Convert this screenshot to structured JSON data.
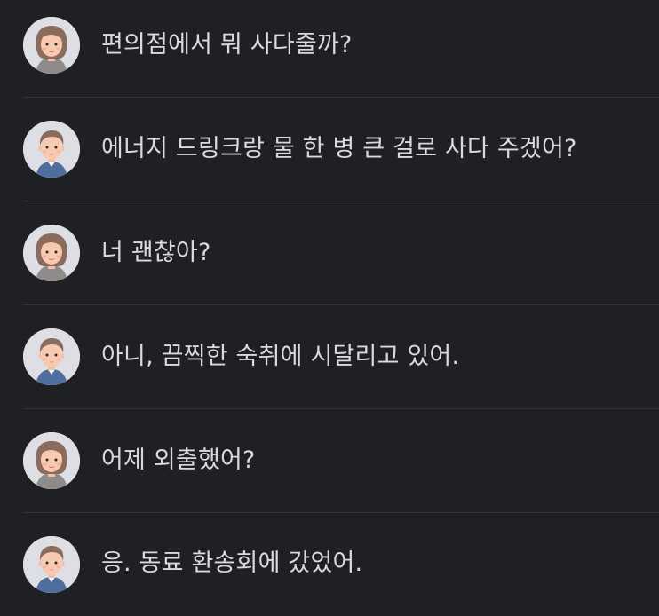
{
  "messages": [
    {
      "speaker": "female-avatar",
      "text": "편의점에서 뭐 사다줄까?"
    },
    {
      "speaker": "male-avatar",
      "text": "에너지 드링크랑 물 한 병 큰 걸로 사다 주겠어?"
    },
    {
      "speaker": "female-avatar",
      "text": "너 괜찮아?"
    },
    {
      "speaker": "male-avatar",
      "text": "아니, 끔찍한 숙취에 시달리고 있어."
    },
    {
      "speaker": "female-avatar",
      "text": "어제 외출했어?"
    },
    {
      "speaker": "male-avatar",
      "text": "응. 동료 환송회에 갔었어."
    }
  ],
  "colors": {
    "background": "#1f2024",
    "divider": "#34353a",
    "text": "#d9dadf",
    "avatar_bg": "#dedfe4"
  }
}
